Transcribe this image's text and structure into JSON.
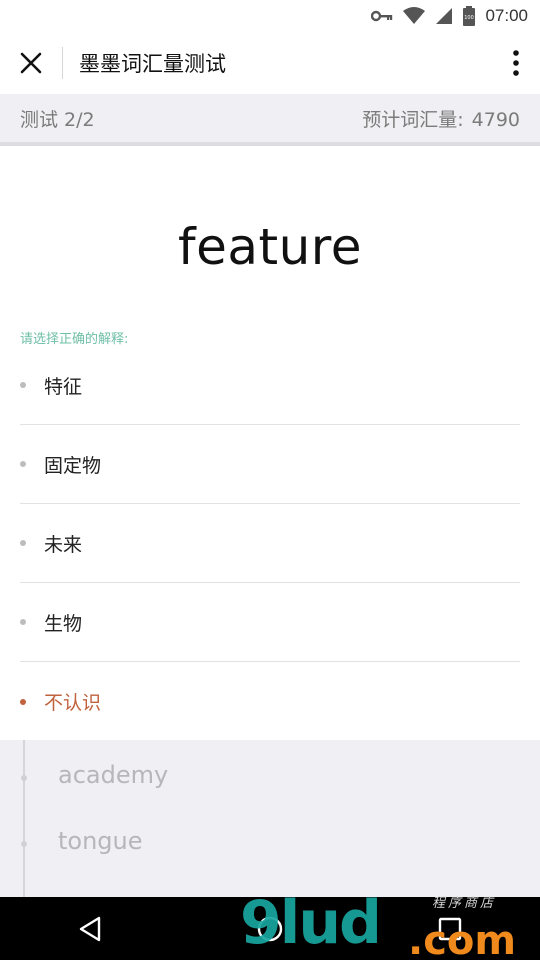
{
  "status_bar": {
    "time": "07:00",
    "battery": "100"
  },
  "app_bar": {
    "title": "墨墨词汇量测试"
  },
  "progress": {
    "test_label": "测试 2/2",
    "estimate_label": "预计词汇量:",
    "estimate_value": "4790"
  },
  "question": {
    "word": "feature",
    "prompt": "请选择正确的解释:",
    "options": [
      {
        "label": "特征"
      },
      {
        "label": "固定物"
      },
      {
        "label": "未来"
      },
      {
        "label": "生物"
      },
      {
        "label": "不认识"
      }
    ]
  },
  "history": {
    "items": [
      {
        "word": "academy"
      },
      {
        "word": "tongue"
      }
    ]
  },
  "watermark": {
    "logo": "9lud",
    "suffix": ".com",
    "tagline": "程序商店"
  },
  "colors": {
    "accent_green": "#6fbfa6",
    "unknown_red": "#c0623e",
    "progress_bg": "#efeff4"
  }
}
